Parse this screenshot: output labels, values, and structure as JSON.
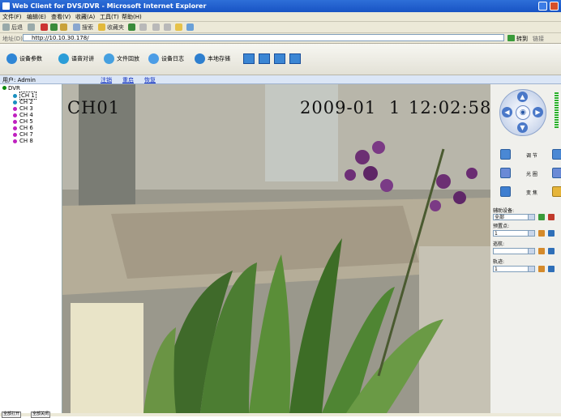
{
  "window": {
    "title": "Web Client for DVS/DVR - Microsoft Internet Explorer"
  },
  "menu": [
    "文件(F)",
    "编辑(E)",
    "查看(V)",
    "收藏(A)",
    "工具(T)",
    "帮助(H)"
  ],
  "browser_toolbar": {
    "back": "后退",
    "search": "搜索",
    "favorites": "收藏夹"
  },
  "address": {
    "label": "地址(D)",
    "url": "http://10.10.30.178/",
    "go": "转到",
    "links": "链接"
  },
  "app_toolbar": {
    "buttons": [
      {
        "label": "设备参数",
        "color": "#2f86d6"
      },
      {
        "label": "语音对讲",
        "color": "#2b9dd8"
      },
      {
        "label": "文件回放",
        "color": "#46a0e0"
      },
      {
        "label": "设备日志",
        "color": "#4c9de6"
      },
      {
        "label": "本地存储",
        "color": "#2e7fcf"
      }
    ]
  },
  "infobar": {
    "user": "用户: Admin",
    "links": [
      "注销",
      "重启",
      "恢复"
    ]
  },
  "tree": {
    "root": "DVR",
    "channels": [
      {
        "label": "CH 1",
        "color": "#1a8fc0",
        "selected": true
      },
      {
        "label": "CH 2",
        "color": "#1a8fc0",
        "selected": false
      },
      {
        "label": "CH 3",
        "color": "#c020c0",
        "selected": false
      },
      {
        "label": "CH 4",
        "color": "#c020c0",
        "selected": false
      },
      {
        "label": "CH 5",
        "color": "#c020c0",
        "selected": false
      },
      {
        "label": "CH 6",
        "color": "#c020c0",
        "selected": false
      },
      {
        "label": "CH 7",
        "color": "#c020c0",
        "selected": false
      },
      {
        "label": "CH 8",
        "color": "#c020c0",
        "selected": false
      }
    ]
  },
  "video": {
    "channel": "CH01",
    "date": "2009-01",
    "day": "1",
    "time": "12:02:58"
  },
  "ptz": {
    "buttons": [
      {
        "label": "调 节",
        "color": "#4a88d4"
      },
      {
        "label": "光 圈",
        "color": "#6a8ad6"
      },
      {
        "label": "变 焦",
        "color": "#3e7ed0"
      }
    ],
    "aux_label": "辅助设备:",
    "aux_value": "全部",
    "preset_label": "预置点:",
    "preset_value": "1",
    "cruise_label": "巡航:",
    "cruise_value": "",
    "track_label": "轨迹:",
    "track_value": "1"
  },
  "bottom": {
    "buttons": [
      "全部打开",
      "全部关闭"
    ]
  }
}
